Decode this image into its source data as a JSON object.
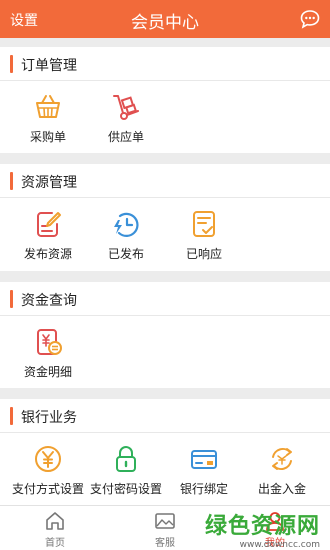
{
  "header": {
    "left_label": "设置",
    "title": "会员中心",
    "message_icon": "chat-bubble-icon",
    "color": "#f26a3a"
  },
  "sections": [
    {
      "title": "订单管理",
      "items": [
        {
          "label": "采购单",
          "icon": "basket-icon"
        },
        {
          "label": "供应单",
          "icon": "hand-truck-icon"
        }
      ]
    },
    {
      "title": "资源管理",
      "items": [
        {
          "label": "发布资源",
          "icon": "edit-document-icon"
        },
        {
          "label": "已发布",
          "icon": "clock-lightning-icon"
        },
        {
          "label": "已响应",
          "icon": "checklist-icon"
        }
      ]
    },
    {
      "title": "资金查询",
      "items": [
        {
          "label": "资金明细",
          "icon": "money-statement-icon"
        }
      ]
    },
    {
      "title": "银行业务",
      "items": [
        {
          "label": "支付方式设置",
          "icon": "yen-coin-icon"
        },
        {
          "label": "支付密码设置",
          "icon": "lock-icon"
        },
        {
          "label": "银行绑定",
          "icon": "bank-card-icon"
        },
        {
          "label": "出金入金",
          "icon": "exchange-icon"
        }
      ]
    }
  ],
  "tabbar": [
    {
      "label": "首页",
      "icon": "home-icon"
    },
    {
      "label": "客服",
      "icon": "image-icon"
    },
    {
      "label": "我的",
      "icon": "user-icon",
      "active": true
    }
  ],
  "watermark": {
    "text": "绿色资源网",
    "url": "www.downcc.com"
  }
}
